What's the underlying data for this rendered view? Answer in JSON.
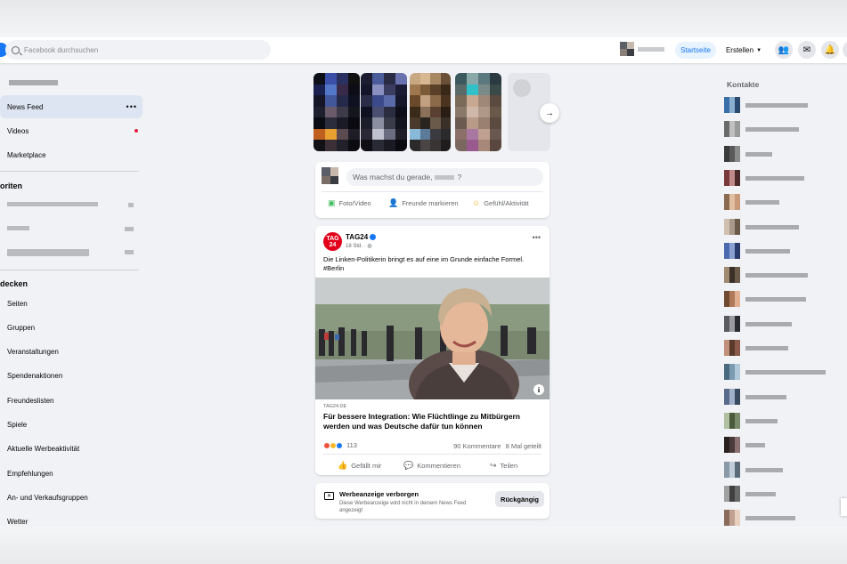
{
  "topbar": {
    "search_placeholder": "Facebook durchsuchen",
    "home_label": "Startseite",
    "create_label": "Erstellen",
    "accent_color": "#1877f2"
  },
  "sidebar": {
    "items": [
      {
        "label": "News Feed",
        "active": true
      },
      {
        "label": "Videos",
        "notification": true
      },
      {
        "label": "Marketplace"
      }
    ],
    "favorites_heading": "oriten",
    "explore_heading": "decken",
    "explore_items": [
      "Seiten",
      "Gruppen",
      "Veranstaltungen",
      "Spendenaktionen",
      "Freundeslisten",
      "Spiele",
      "Aktuelle Werbeaktivität",
      "Empfehlungen",
      "An- und Verkaufsgruppen",
      "Wetter"
    ]
  },
  "composer": {
    "placeholder": "Was machst du gerade,",
    "placeholder_suffix": "?",
    "actions": [
      {
        "label": "Foto/Video",
        "icon": "photo-icon",
        "color": "#45bd62"
      },
      {
        "label": "Freunde markieren",
        "icon": "tag-friends-icon",
        "color": "#1877f2"
      },
      {
        "label": "Gefühl/Aktivität",
        "icon": "feeling-icon",
        "color": "#f7b928"
      }
    ]
  },
  "post": {
    "page_name": "TAG24",
    "logo_text": "TAG 24",
    "time": "18 Std.",
    "text": "Die Linken-Politikerin bringt es auf eine im Grunde einfache Formel. #Berlin",
    "link_domain": "TAG24.DE",
    "headline": "Für bessere Integration: Wie Flüchtlinge zu Mitbürgern werden und was Deutsche dafür tun können",
    "reaction_count": "113",
    "comments": "90 Kommentare",
    "shares": "8 Mal geteilt",
    "actions": [
      "Gefällt mir",
      "Kommentieren",
      "Teilen"
    ]
  },
  "ad_hidden": {
    "title": "Werbeanzeige verborgen",
    "text": "Diese Werbeanzeige wird nicht in deinem News Feed angezeigt",
    "undo_label": "Rückgängig"
  },
  "contacts": {
    "heading": "Kontakte"
  }
}
